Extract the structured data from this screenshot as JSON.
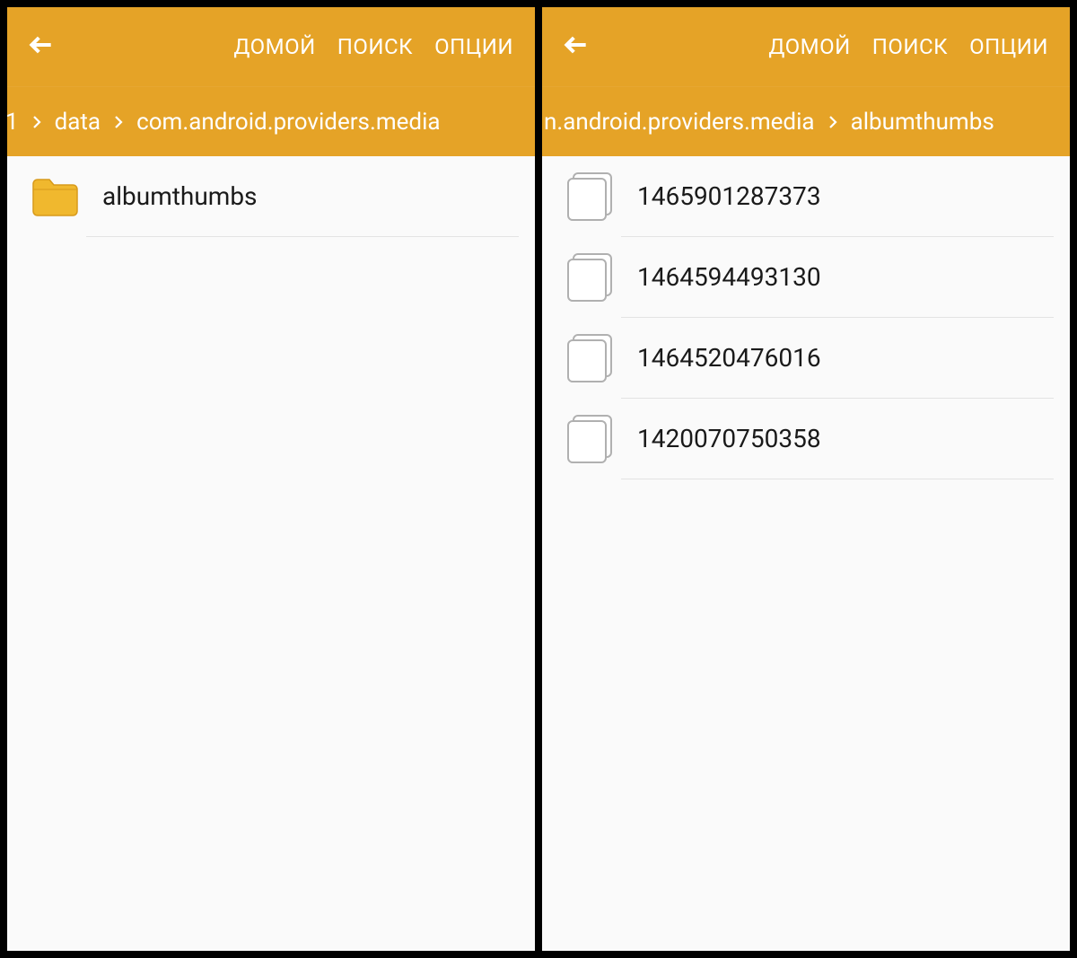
{
  "header": {
    "actions": {
      "home": "ДОМОЙ",
      "search": "ПОИСК",
      "options": "ОПЦИИ"
    }
  },
  "left": {
    "breadcrumb": {
      "seg0_partial": "1",
      "seg1": "data",
      "seg2": "com.android.providers.media"
    },
    "items": [
      {
        "name": "albumthumbs"
      }
    ]
  },
  "right": {
    "breadcrumb": {
      "seg0_partial": "n.android.providers.media",
      "seg1": "albumthumbs"
    },
    "items": [
      {
        "name": "1465901287373"
      },
      {
        "name": "1464594493130"
      },
      {
        "name": "1464520476016"
      },
      {
        "name": "1420070750358"
      }
    ]
  },
  "colors": {
    "accent": "#e5a327",
    "bg": "#fafafa"
  }
}
